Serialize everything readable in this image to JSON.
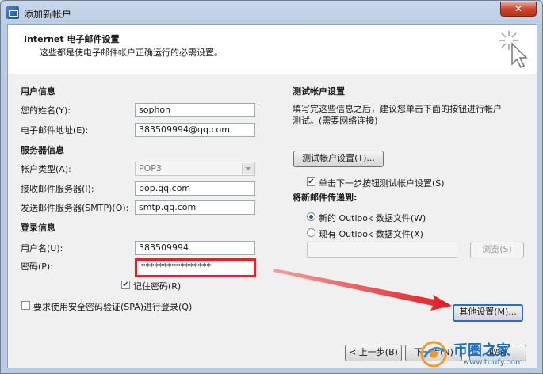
{
  "window": {
    "title": "添加新帐户",
    "close_glyph": "✕"
  },
  "header": {
    "title": "Internet 电子邮件设置",
    "subtitle": "这些都是使电子邮件帐户正确运行的必需设置。",
    "icon": "cursor-sparkle-icon"
  },
  "user_info": {
    "heading": "用户信息",
    "name_label": "您的姓名(Y):",
    "name_value": "sophon",
    "email_label": "电子邮件地址(E):",
    "email_value": "383509994@qq.com"
  },
  "server_info": {
    "heading": "服务器信息",
    "account_type_label": "帐户类型(A):",
    "account_type_value": "POP3",
    "incoming_label": "接收邮件服务器(I):",
    "incoming_value": "pop.qq.com",
    "outgoing_label": "发送邮件服务器(SMTP)(O):",
    "outgoing_value": "smtp.qq.com"
  },
  "login_info": {
    "heading": "登录信息",
    "username_label": "用户名(U):",
    "username_value": "383509994",
    "password_label": "密码(P):",
    "password_value": "****************",
    "remember_label": "记住密码(R)",
    "remember_checked": true,
    "spa_label": "要求使用安全密码验证(SPA)进行登录(Q)",
    "spa_checked": false
  },
  "test_settings": {
    "heading": "测试帐户设置",
    "description_line1": "填写完这些信息之后，建议您单击下面的按钮进行帐户",
    "description_line2": "测试。(需要网络连接)",
    "test_button": "测试帐户设置(T)...",
    "auto_test_label": "单击下一步按钮测试帐户设置(S)",
    "auto_test_checked": true
  },
  "deliver_to": {
    "heading": "将新邮件传递到:",
    "option_new": "新的 Outlook 数据文件(W)",
    "option_existing": "现有 Outlook 数据文件(X)",
    "selected": "new",
    "path_value": "",
    "browse_button": "浏览(S)"
  },
  "more_settings_button": "其他设置(M)...",
  "footer": {
    "back_button": "< 上一步(B)",
    "next_button": "下一步(N)",
    "cancel_button": "取消"
  },
  "watermark": {
    "text": "币圈之家",
    "url": "www.tuufy.com"
  },
  "colors": {
    "highlight_red": "#d7262c",
    "accent_blue": "#2b6cc6",
    "dialog_bg": "#f0f0f0"
  }
}
